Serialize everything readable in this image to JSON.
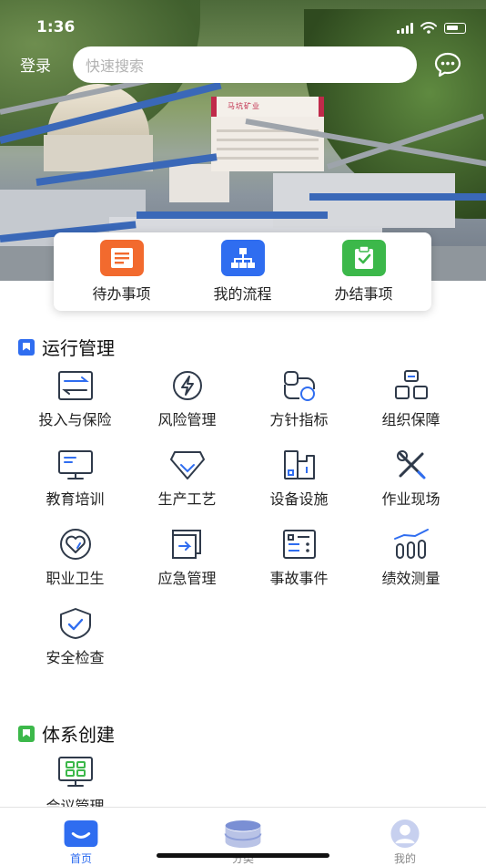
{
  "status_bar": {
    "time": "1:36"
  },
  "header": {
    "login_label": "登录",
    "search_placeholder": "快速搜索",
    "message_icon": "chat-bubble-icon"
  },
  "hero": {
    "sign_text": "马坑矿业"
  },
  "quick_actions": [
    {
      "label": "待办事项",
      "icon": "todo-list-icon",
      "color": "#f26a2e"
    },
    {
      "label": "我的流程",
      "icon": "org-chart-icon",
      "color": "#2f6df0"
    },
    {
      "label": "办结事项",
      "icon": "clipboard-check-icon",
      "color": "#3cb84a"
    }
  ],
  "sections": [
    {
      "title": "运行管理",
      "flag_color": "#2f6df0",
      "items": [
        {
          "label": "投入与保险",
          "icon": "transfer-icon"
        },
        {
          "label": "风险管理",
          "icon": "lightning-icon"
        },
        {
          "label": "方针指标",
          "icon": "target-icon"
        },
        {
          "label": "组织保障",
          "icon": "blocks-icon"
        },
        {
          "label": "教育培训",
          "icon": "monitor-icon"
        },
        {
          "label": "生产工艺",
          "icon": "gem-icon"
        },
        {
          "label": "设备设施",
          "icon": "equipment-icon"
        },
        {
          "label": "作业现场",
          "icon": "tools-icon"
        },
        {
          "label": "职业卫生",
          "icon": "heart-icon"
        },
        {
          "label": "应急管理",
          "icon": "exit-icon"
        },
        {
          "label": "事故事件",
          "icon": "list-icon"
        },
        {
          "label": "绩效测量",
          "icon": "bar-chart-icon"
        },
        {
          "label": "安全检查",
          "icon": "shield-check-icon"
        }
      ]
    },
    {
      "title": "体系创建",
      "flag_color": "#3cb84a",
      "items": [
        {
          "label": "会议管理",
          "icon": "meeting-icon"
        }
      ]
    }
  ],
  "tabbar": [
    {
      "label": "首页",
      "icon": "home-icon",
      "active": true
    },
    {
      "label": "分类",
      "icon": "database-icon",
      "active": false
    },
    {
      "label": "我的",
      "icon": "user-icon",
      "active": false
    }
  ],
  "colors": {
    "accent": "#2f6df0",
    "icon_stroke": "#2f3a4a",
    "icon_accent": "#2f6df0"
  }
}
